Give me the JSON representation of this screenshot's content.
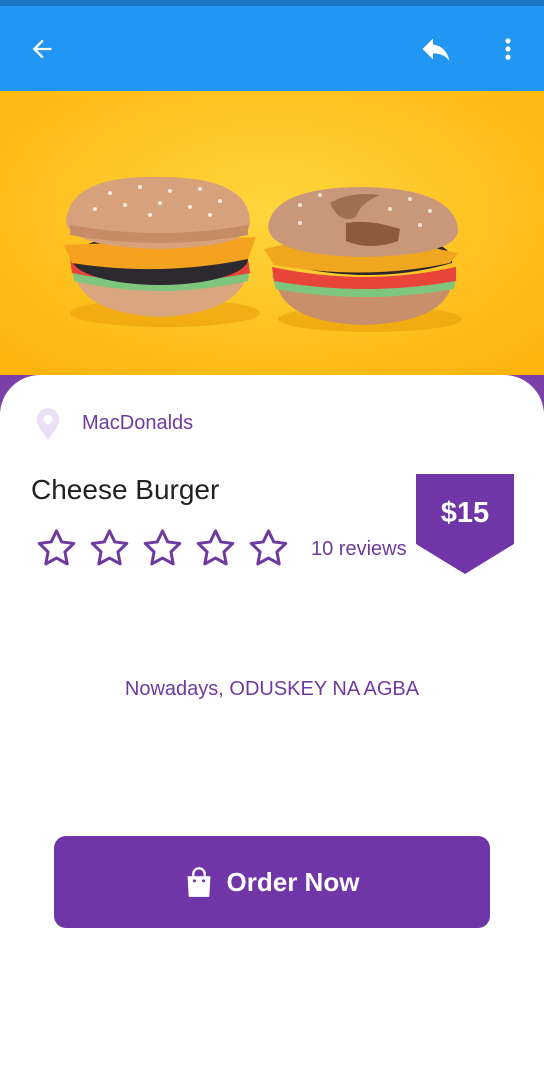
{
  "colors": {
    "app_bar": "#2196f3",
    "accent_purple": "#7035a6",
    "hero_background": "#ffc21a",
    "text_dark": "#222222"
  },
  "app_bar": {
    "back_icon": "arrow-left-icon",
    "reply_icon": "reply-icon",
    "more_icon": "more-vert-icon"
  },
  "hero": {
    "image": "two-macaron-burgers"
  },
  "product": {
    "location_icon": "map-pin-icon",
    "location": "MacDonalds",
    "title": "Cheese Burger",
    "rating": 0,
    "rating_max": 5,
    "reviews": "10 reviews",
    "price": "$15",
    "description": "Nowadays, ODUSKEY NA AGBA"
  },
  "actions": {
    "order_icon": "shopping-bag-icon",
    "order_label": "Order Now"
  }
}
